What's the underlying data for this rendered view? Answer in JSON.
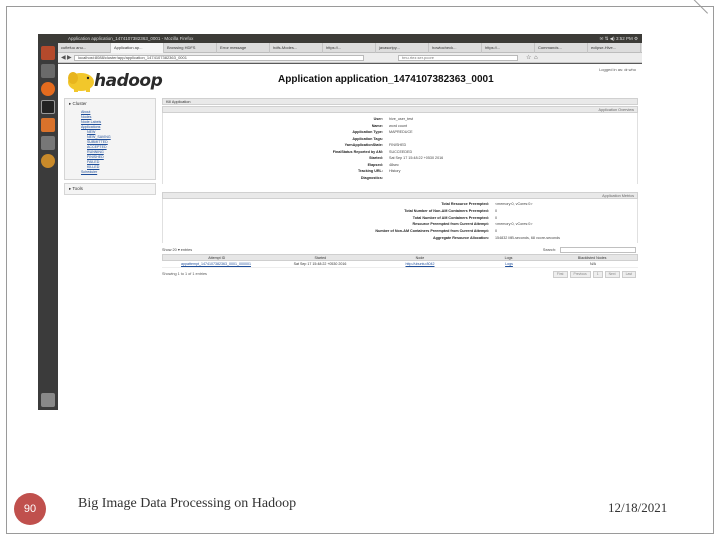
{
  "slide": {
    "page_number": "90",
    "footer_title": "Big Image Data Processing on Hadoop",
    "date": "12/18/2021"
  },
  "os": {
    "window_title": "Application application_1474107382363_0001 - Mozilla Firefox",
    "clock": "3:52 PM"
  },
  "browser": {
    "tabs": [
      {
        "label": "cuflefuu anu...",
        "active": false
      },
      {
        "label": "Application ap...",
        "active": true
      },
      {
        "label": "Browsing HDFS",
        "active": false
      },
      {
        "label": "Error message",
        "active": false
      },
      {
        "label": "hdfs-Modes...",
        "active": false
      },
      {
        "label": "https://...",
        "active": false
      },
      {
        "label": "javascripy...",
        "active": false
      },
      {
        "label": "howtocheck...",
        "active": false
      },
      {
        "label": "https://...",
        "active": false
      },
      {
        "label": "Commands...",
        "active": false
      },
      {
        "label": "eclipse-Hive...",
        "active": false
      }
    ],
    "url": "localhost:8088/cluster/app/application_1474107382363_0001",
    "search_placeholder": "tmu.rtez.ser.pcore"
  },
  "header": {
    "logo_text": "hadoop",
    "logged_in": "Logged in as: dr.who",
    "title": "Application application_1474107382363_0001"
  },
  "sidebar": {
    "cluster_label": "▸ Cluster",
    "cluster_links": [
      {
        "label": "About",
        "sub": false
      },
      {
        "label": "Nodes",
        "sub": false
      },
      {
        "label": "Node Labels",
        "sub": false
      },
      {
        "label": "Applications",
        "sub": false
      },
      {
        "label": "NEW",
        "sub": true
      },
      {
        "label": "NEW_SAVING",
        "sub": true
      },
      {
        "label": "SUBMITTED",
        "sub": true
      },
      {
        "label": "ACCEPTED",
        "sub": true
      },
      {
        "label": "RUNNING",
        "sub": true
      },
      {
        "label": "FINISHED",
        "sub": true
      },
      {
        "label": "FAILED",
        "sub": true
      },
      {
        "label": "KILLED",
        "sub": true
      },
      {
        "label": "Scheduler",
        "sub": false
      }
    ],
    "tools_label": "▸ Tools"
  },
  "overview": {
    "kill_button": "Kill Application",
    "section_label": "Application Overview",
    "rows": [
      {
        "k": "User:",
        "v": "hive_user_test"
      },
      {
        "k": "Name:",
        "v": "word count"
      },
      {
        "k": "Application Type:",
        "v": "MAPREDUCE"
      },
      {
        "k": "Application Tags:",
        "v": ""
      },
      {
        "k": "YarnApplicationState:",
        "v": "FINISHED"
      },
      {
        "k": "FinalStatus Reported by AM:",
        "v": "SUCCEEDED"
      },
      {
        "k": "Started:",
        "v": "Sat Sep 17 15:48:22 +0530 2016"
      },
      {
        "k": "Elapsed:",
        "v": "48sec"
      },
      {
        "k": "Tracking URL:",
        "v": "History"
      },
      {
        "k": "Diagnostics:",
        "v": ""
      }
    ]
  },
  "metrics": {
    "section_label": "Application Metrics",
    "rows": [
      {
        "k": "Total Resource Preempted:",
        "v": "<memory:0, vCores:0>"
      },
      {
        "k": "Total Number of Non-AM Containers Preempted:",
        "v": "0"
      },
      {
        "k": "Total Number of AM Containers Preempted:",
        "v": "0"
      },
      {
        "k": "Resource Preempted from Current Attempt:",
        "v": "<memory:0, vCores:0>"
      },
      {
        "k": "Number of Non-AM Containers Preempted from Current Attempt:",
        "v": "0"
      },
      {
        "k": "Aggregate Resource Allocation:",
        "v": "154832 MB-seconds, 68 vcore-seconds"
      }
    ]
  },
  "attempts": {
    "show_label": "Show 20 ▾ entries",
    "search_label": "Search:",
    "columns": [
      "Attempt ID",
      "Started",
      "Node",
      "Logs",
      "Blacklisted Nodes"
    ],
    "rows": [
      [
        "appattempt_1474107382363_0001_000001",
        "Sat Sep 17 15:48:22 +0530 2016",
        "http://ubuntu:8042",
        "Logs",
        "N/A"
      ]
    ],
    "info": "Showing 1 to 1 of 1 entries",
    "pager": [
      "First",
      "Previous",
      "1",
      "Next",
      "Last"
    ]
  },
  "colors": {
    "badge": "#c0504d",
    "launcher": "#3b3b3b",
    "link": "#1e4e9a"
  }
}
